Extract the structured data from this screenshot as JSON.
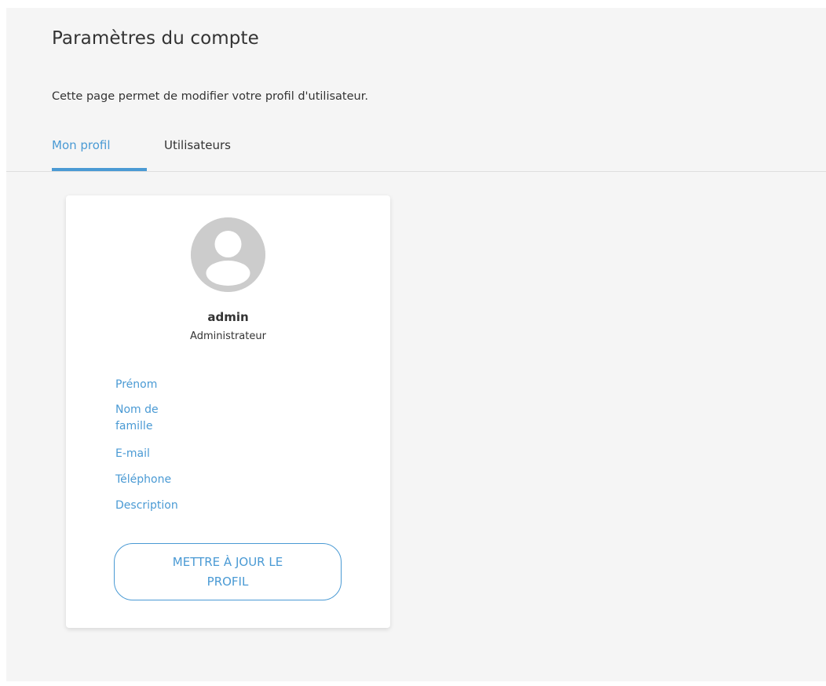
{
  "header": {
    "title": "Paramètres du compte",
    "description": "Cette page permet de modifier votre profil d'utilisateur."
  },
  "tabs": [
    {
      "label": "Mon profil",
      "active": true
    },
    {
      "label": "Utilisateurs",
      "active": false
    }
  ],
  "profile": {
    "username": "admin",
    "role": "Administrateur",
    "avatar_icon": "user-avatar-icon",
    "fields": [
      {
        "label": "Prénom"
      },
      {
        "label": "Nom de famille"
      },
      {
        "label": "E-mail"
      },
      {
        "label": "Téléphone"
      },
      {
        "label": "Description"
      }
    ],
    "update_button": "METTRE À JOUR LE PROFIL"
  },
  "colors": {
    "accent": "#4a9ad4",
    "background": "#f5f5f5",
    "avatar": "#cccccc"
  }
}
